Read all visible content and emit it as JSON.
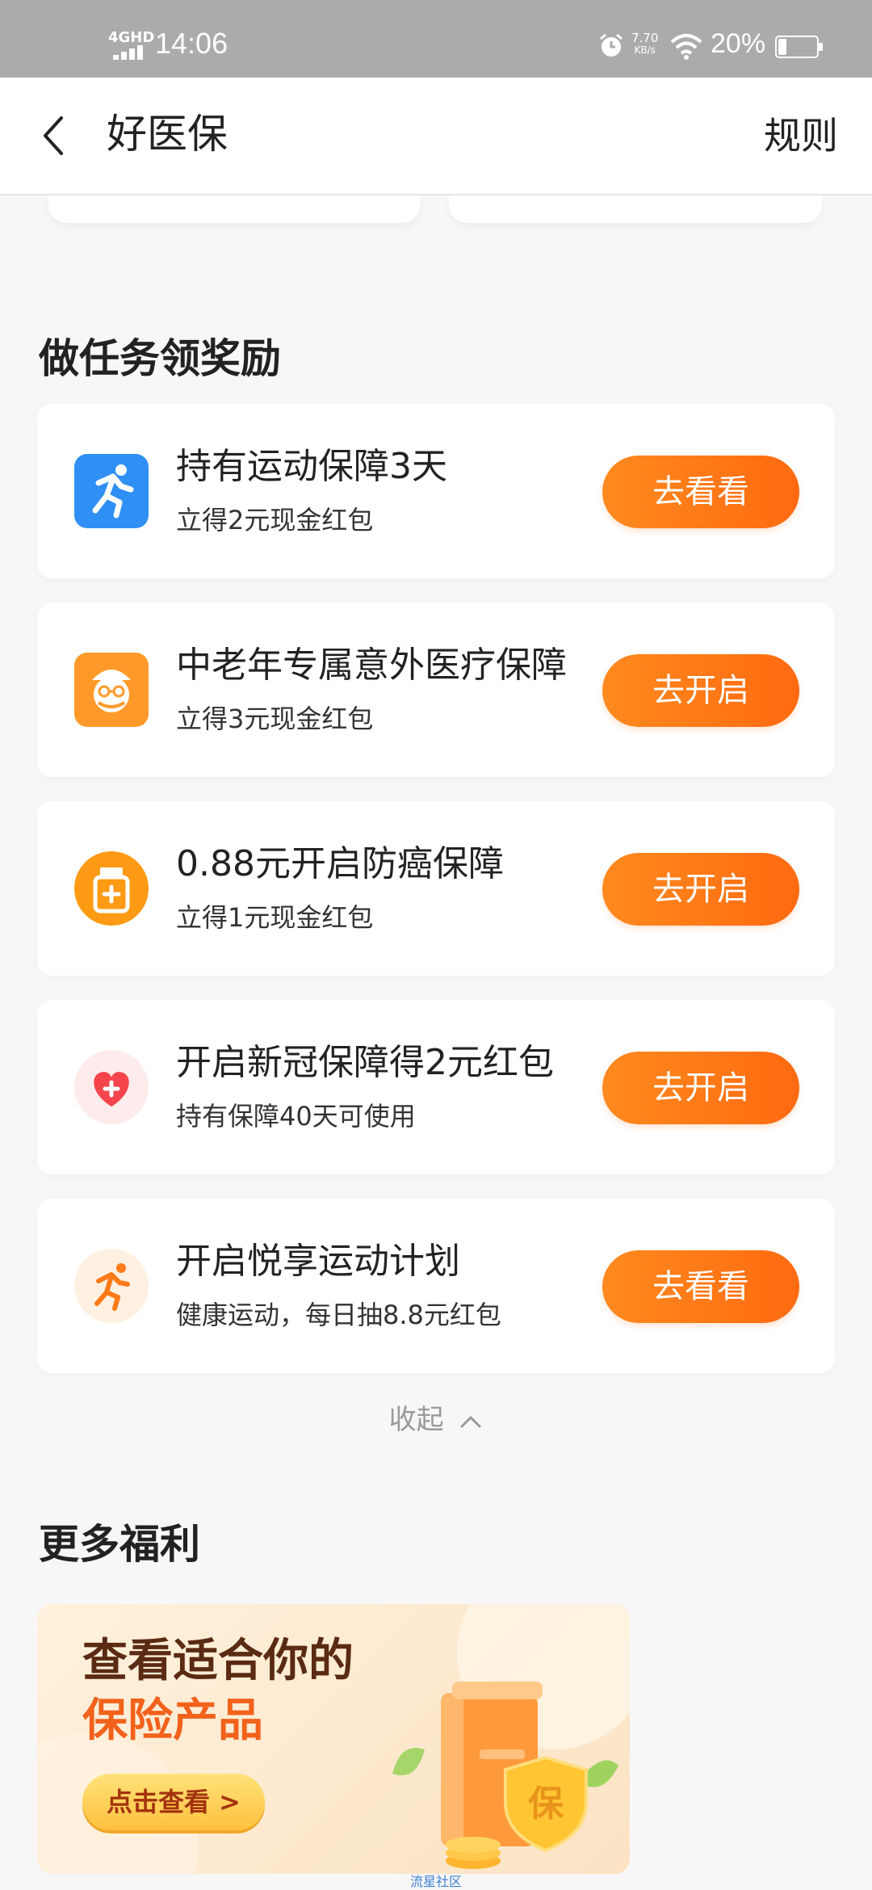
{
  "status_bar": {
    "network": "4GHD",
    "time": "14:06",
    "speed_value": "7.70",
    "speed_unit": "KB/s",
    "battery": "20%",
    "icons": [
      "signal-icon",
      "alarm-icon",
      "wifi-icon",
      "battery-icon"
    ]
  },
  "nav": {
    "title": "好医保",
    "rules": "规则",
    "back_icon": "chevron-left-icon"
  },
  "tasks_section": {
    "title": "做任务领奖励",
    "tasks": [
      {
        "icon": "running-icon",
        "title": "持有运动保障3天",
        "subtitle": "立得2元现金红包",
        "button": "去看看"
      },
      {
        "icon": "elder-icon",
        "title": "中老年专属意外医疗保障",
        "subtitle": "立得3元现金红包",
        "button": "去开启"
      },
      {
        "icon": "medicine-bottle-icon",
        "title": "0.88元开启防癌保障",
        "subtitle": "立得1元现金红包",
        "button": "去开启"
      },
      {
        "icon": "heart-plus-icon",
        "title": "开启新冠保障得2元红包",
        "subtitle": "持有保障40天可使用",
        "button": "去开启"
      },
      {
        "icon": "runner-icon",
        "title": "开启悦享运动计划",
        "subtitle": "健康运动，每日抽8.8元红包",
        "button": "去看看"
      }
    ],
    "collapse_label": "收起"
  },
  "more_section": {
    "title": "更多福利",
    "promo": {
      "line1": "查看适合你的",
      "line2": "保险产品",
      "button": "点击查看 >",
      "badge_char": "保"
    }
  },
  "watermark": "流星社区",
  "colors": {
    "accent": "#ff7a18",
    "accent_dark": "#ff6a10",
    "blue_icon": "#2f8ff5",
    "orange_icon": "#ff9a2a",
    "heart": "#f5444b"
  }
}
